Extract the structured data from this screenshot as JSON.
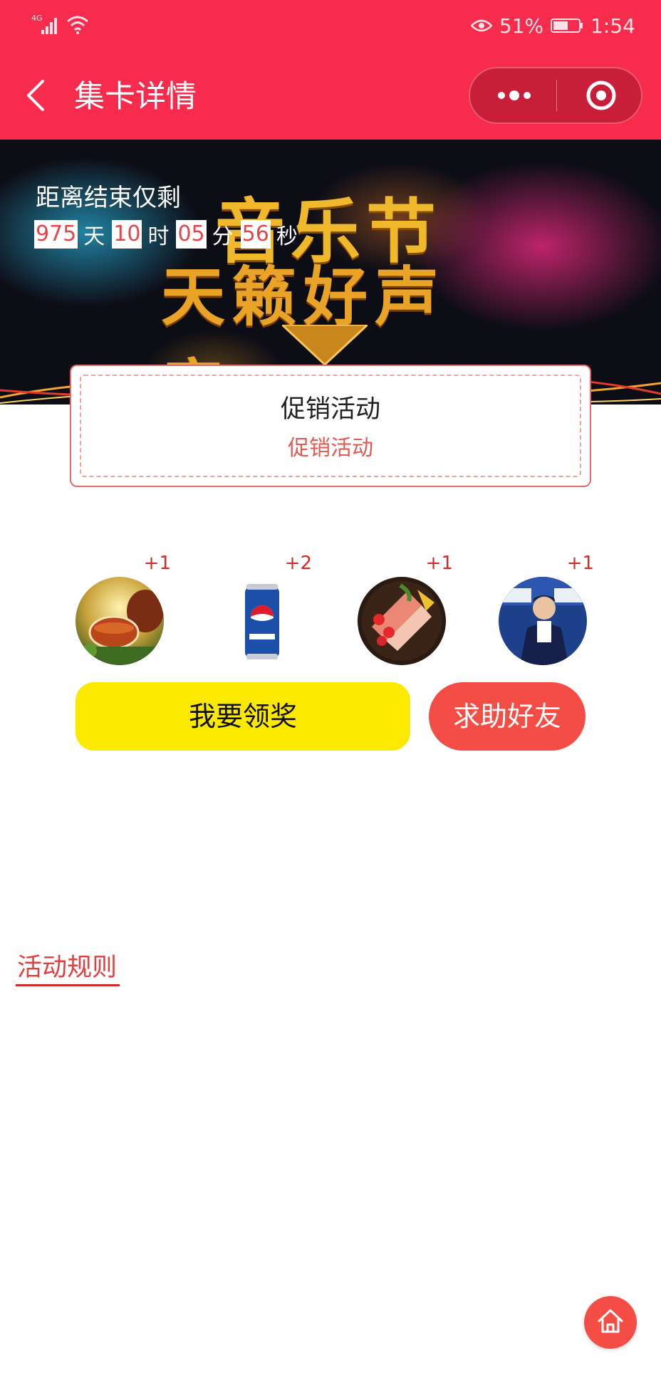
{
  "status_bar": {
    "network": "4G",
    "battery_percent": "51%",
    "time": "1:54"
  },
  "nav": {
    "title": "集卡详情"
  },
  "banner": {
    "line1": "音乐节",
    "line2": "天籁好声音"
  },
  "countdown": {
    "label": "距离结束仅剩",
    "days": "975",
    "days_unit": "天",
    "hours": "10",
    "hours_unit": "时",
    "minutes": "05",
    "minutes_unit": "分",
    "seconds": "56",
    "seconds_unit": "秒"
  },
  "promo": {
    "title": "促销活动",
    "subtitle": "促销活动"
  },
  "cards": [
    {
      "count": "+1",
      "icon": "tea-image"
    },
    {
      "count": "+2",
      "icon": "pepsi-can-image"
    },
    {
      "count": "+1",
      "icon": "food-platter-image"
    },
    {
      "count": "+1",
      "icon": "poster-image"
    }
  ],
  "buttons": {
    "claim": "我要领奖",
    "help": "求助好友"
  },
  "rules": {
    "title": "活动规则"
  },
  "colors": {
    "header": "#f72b4b",
    "claim_button": "#fbea00",
    "help_button": "#f44d46",
    "accent_red": "#e04040"
  }
}
